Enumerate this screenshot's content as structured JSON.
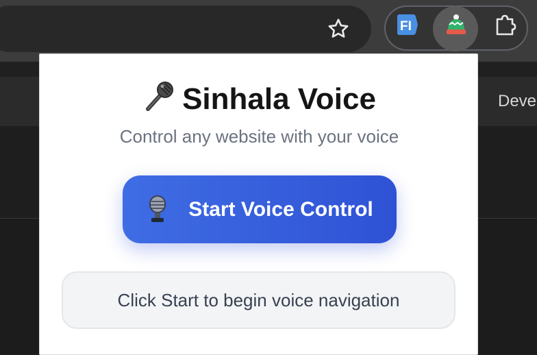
{
  "browser": {
    "bookmark_icon": "star-outline-icon",
    "extensions": [
      {
        "name": "FI",
        "icon": "fi-extension-icon"
      },
      {
        "name": "hat",
        "icon": "knit-hat-extension-icon"
      },
      {
        "name": "extensions",
        "icon": "puzzle-piece-icon"
      }
    ],
    "background_text": "Deve"
  },
  "popup": {
    "title_icon": "microphone-icon",
    "title": "Sinhala Voice",
    "subtitle": "Control any website with your voice",
    "start_button": {
      "icon": "studio-microphone-icon",
      "label": "Start Voice Control"
    },
    "status_text": "Click Start to begin voice navigation"
  },
  "colors": {
    "accent_start": "#3f6de4",
    "accent_end": "#2f52d5",
    "subtitle": "#6b7280",
    "status_bg": "#f3f4f6"
  }
}
